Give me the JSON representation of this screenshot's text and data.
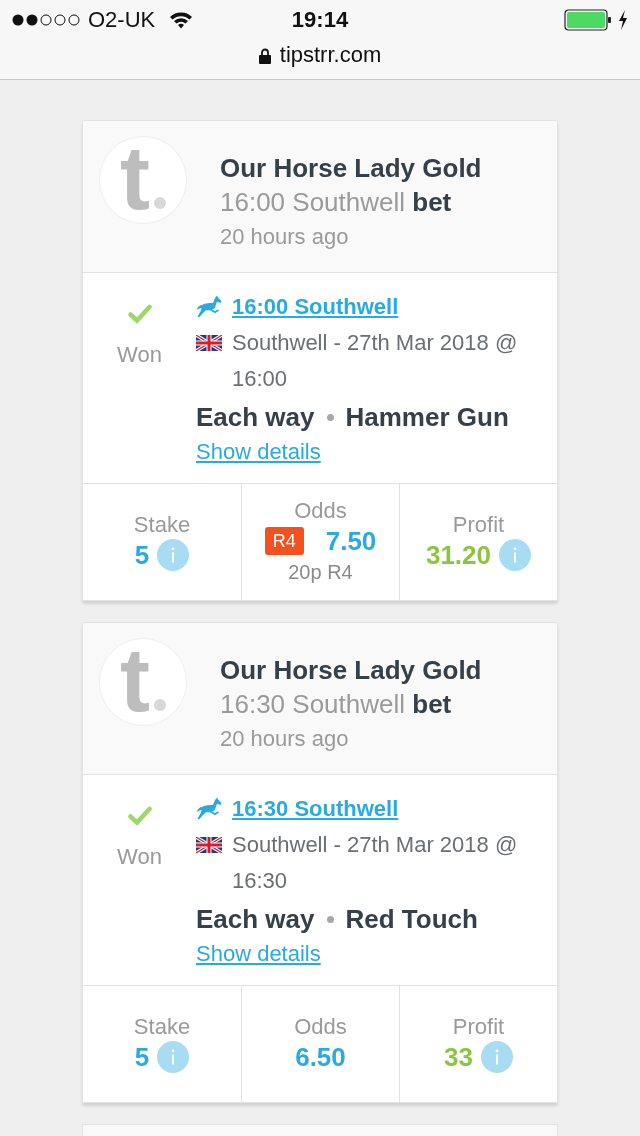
{
  "status_bar": {
    "carrier": "O2-UK",
    "time": "19:14"
  },
  "address_bar": {
    "url": "tipstrr.com"
  },
  "cards": [
    {
      "logo": "t",
      "tipster": "Our Horse Lady Gold",
      "subtitle": "16:00 Southwell **bet**",
      "posted": "20 hours ago",
      "result": {
        "label": "Won",
        "kind": "won"
      },
      "race_link": "16:00 Southwell",
      "meeting": "Southwell - 27th Mar 2018 @ 16:00",
      "bet_type": "Each way",
      "selection": "Hammer Gun",
      "details_link": "Show details",
      "stats": [
        {
          "kind": "stake",
          "label": "Stake",
          "value": "5",
          "info": true
        },
        {
          "kind": "odds",
          "label": "Odds",
          "badge": "R4",
          "value": "7.50",
          "note": "20p R4",
          "info": false
        },
        {
          "kind": "profit",
          "label": "Profit",
          "value": "31.20",
          "info": true
        }
      ]
    },
    {
      "logo": "t",
      "tipster": "Our Horse Lady Gold",
      "subtitle": "16:30 Southwell **bet**",
      "posted": "20 hours ago",
      "result": {
        "label": "Won",
        "kind": "won"
      },
      "race_link": "16:30 Southwell",
      "meeting": "Southwell - 27th Mar 2018 @ 16:30",
      "bet_type": "Each way",
      "selection": "Red Touch",
      "details_link": "Show details",
      "stats": [
        {
          "kind": "stake",
          "label": "Stake",
          "value": "5",
          "info": true
        },
        {
          "kind": "odds",
          "label": "Odds",
          "value": "6.50",
          "info": false
        },
        {
          "kind": "profit",
          "label": "Profit",
          "value": "33",
          "info": true
        }
      ]
    }
  ]
}
